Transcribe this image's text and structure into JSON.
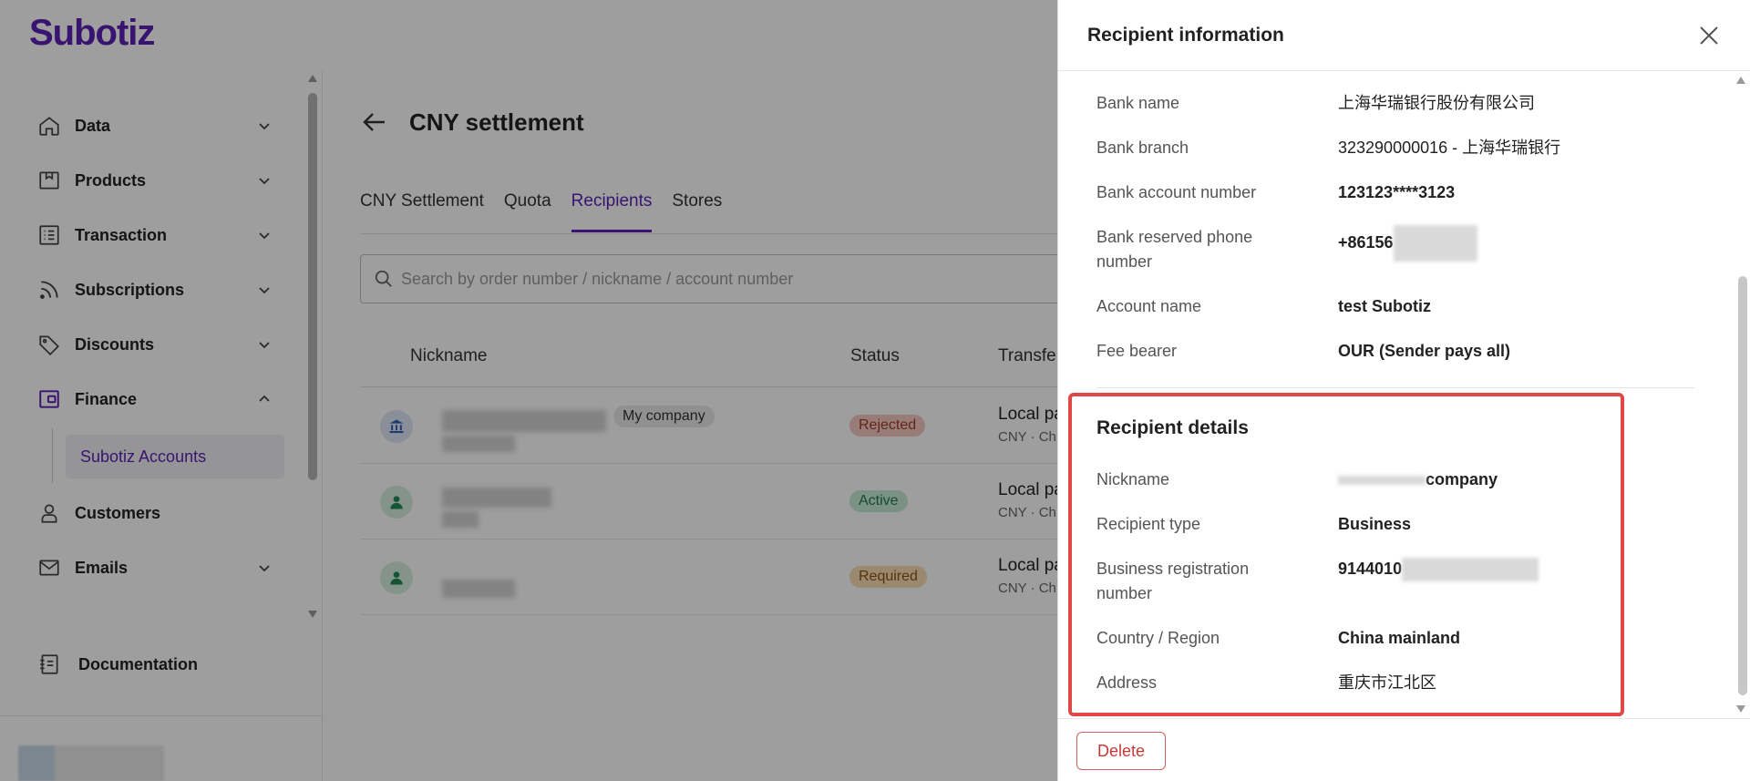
{
  "app": {
    "logo": "Subotiz"
  },
  "sidebar": {
    "items": [
      {
        "label": "Data",
        "icon": "home-icon"
      },
      {
        "label": "Products",
        "icon": "box-icon"
      },
      {
        "label": "Transaction",
        "icon": "list-icon"
      },
      {
        "label": "Subscriptions",
        "icon": "rss-icon"
      },
      {
        "label": "Discounts",
        "icon": "tag-icon"
      },
      {
        "label": "Finance",
        "icon": "wallet-icon"
      },
      {
        "label": "Customers",
        "icon": "user-icon"
      },
      {
        "label": "Emails",
        "icon": "mail-icon"
      }
    ],
    "finance_sub": "Subotiz Accounts",
    "documentation": "Documentation"
  },
  "page": {
    "title": "CNY settlement",
    "tabs": [
      "CNY Settlement",
      "Quota",
      "Recipients",
      "Stores"
    ],
    "active_tab": "Recipients",
    "search_placeholder": "Search by order number / nickname / account number",
    "columns": [
      "Nickname",
      "Status",
      "Transfe"
    ],
    "rows": [
      {
        "chip": "My company",
        "status": "Rejected",
        "type": "Local pa",
        "sub": "CNY · Ch"
      },
      {
        "chip": "",
        "status": "Active",
        "type": "Local pa",
        "sub": "CNY · Ch"
      },
      {
        "chip": "",
        "status": "Required",
        "type": "Local pa",
        "sub": "CNY · Ch"
      }
    ]
  },
  "drawer": {
    "title": "Recipient information",
    "bank": [
      {
        "label": "Bank name",
        "value": "上海华瑞银行股份有限公司"
      },
      {
        "label": "Bank branch",
        "value": "323290000016 - 上海华瑞银行"
      },
      {
        "label": "Bank account number",
        "value": "123123****3123"
      },
      {
        "label": "Bank reserved phone number",
        "value": "+86156"
      },
      {
        "label": "Account name",
        "value": "test Subotiz"
      },
      {
        "label": "Fee bearer",
        "value": "OUR (Sender pays all)"
      }
    ],
    "details_title": "Recipient details",
    "details": [
      {
        "label": "Nickname",
        "value": "company"
      },
      {
        "label": "Recipient type",
        "value": "Business"
      },
      {
        "label": "Business registration number",
        "value": "9144010"
      },
      {
        "label": "Country / Region",
        "value": "China mainland"
      },
      {
        "label": "Address",
        "value": "重庆市江北区"
      }
    ],
    "delete_label": "Delete"
  }
}
